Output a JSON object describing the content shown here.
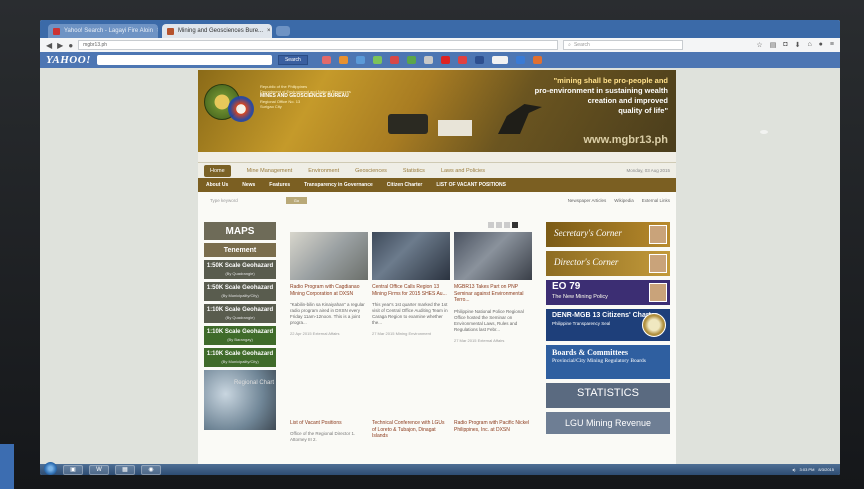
{
  "browser": {
    "tabs": [
      {
        "label": "Yahoo! Search - Lagayi Fire Aloin"
      },
      {
        "label": "Mining and Geosciences Bure..."
      }
    ],
    "url": "mgbr13.ph",
    "search_placeholder": "Search",
    "yahoo_logo": "YAHOO!",
    "yahoo_search_button": "Search"
  },
  "site": {
    "agency_lines": [
      "Republic of the Philippines",
      "Department of Environment and Natural Resources",
      "MINES AND GEOSCIENCES BUREAU",
      "Regional Office No. 13",
      "Surigao City"
    ],
    "quote_line1": "\"mining shall be pro-people and",
    "quote_line2": "pro-environment in sustaining wealth",
    "quote_line3": "creation and improved",
    "quote_line4": "quality of life\"",
    "website": "www.mgbr13.ph",
    "date": "Monday, 03 Aug 2015",
    "menu1": [
      "Home",
      "Mine Management",
      "Environment",
      "Geosciences",
      "Statistics",
      "Laws and Policies"
    ],
    "menu2": [
      "About Us",
      "News",
      "Features",
      "Transparency in Governance",
      "Citizen Charter",
      "LIST OF VACANT POSITIONS"
    ],
    "search_text": "Type keyword",
    "search_button": "Go",
    "menu3_links": [
      "Newspaper Articles",
      "Wikipedia",
      "External Links"
    ]
  },
  "maps": {
    "title": "MAPS",
    "tenement": "Tenement",
    "items": [
      {
        "label": "1:50K Scale Geohazard",
        "sub": "(By Quadrangle)"
      },
      {
        "label": "1:50K Scale Geohazard",
        "sub": "(By Municipality/City)"
      },
      {
        "label": "1:10K Scale Geohazard",
        "sub": "(By Quadrangle)"
      },
      {
        "label": "1:10K Scale Geohazard",
        "sub": "(By Barangay)"
      },
      {
        "label": "1:10K Scale Geohazard",
        "sub": "(By Municipality/City)"
      }
    ],
    "splash_text": "Regional Chart"
  },
  "articles": [
    {
      "title": "Radio Program with Cagdianao Mining Corporation at DXSN",
      "body": "\"Kabilin-bilin sa Kinaiyahan\" a regular radio program aired in DXSN every Friday 11am-12noon. This is a joint progra...",
      "meta": "22 Apr 2015 External Affairs"
    },
    {
      "title": "Central Office Calls Region 13 Mining Firms for 2015 SHES Au...",
      "body": "This year's 1st quarter marked the 1st visit of Central Office Auditing Team in Caraga Region to examine whether the...",
      "meta": "27 Mar 2015 Mining Environment"
    },
    {
      "title": "MGBR13 Takes Part on PNP Seminar against Environmental Terro...",
      "body": "Philippine National Police Regional Office hosted the Seminar on Environmental Laws, Rules and Regulations last Febr...",
      "meta": "27 Mar 2015 External Affairs"
    }
  ],
  "articles2": [
    {
      "title": "List of Vacant Positions",
      "body": "Office of the Regional Director 1. Attorney III 2."
    },
    {
      "title": "Technical Conference with LGUs of Loreto & Tubajon, Dinagat Islands",
      "body": ""
    },
    {
      "title": "Radio Program with Pacific Nickel Philippines, Inc. at DXSN",
      "body": ""
    }
  ],
  "right": {
    "secretary": "Secretary's Corner",
    "director": "Director's Corner",
    "eo_title": "EO 79",
    "eo_sub": "The New Mining Policy",
    "charter_title": "DENR-MGB 13 Citizens' Charter",
    "charter_sub": "Philippine Transparency Seal",
    "boards_title": "Boards & Committees",
    "boards_sub": "Provincial/City Mining Regulatory Boards",
    "statistics": "STATISTICS",
    "lgu": "LGU Mining Revenue"
  },
  "taskbar": {
    "word_icon": "W",
    "tray_time": "3:03 PM",
    "tray_date": "8/3/2015"
  }
}
